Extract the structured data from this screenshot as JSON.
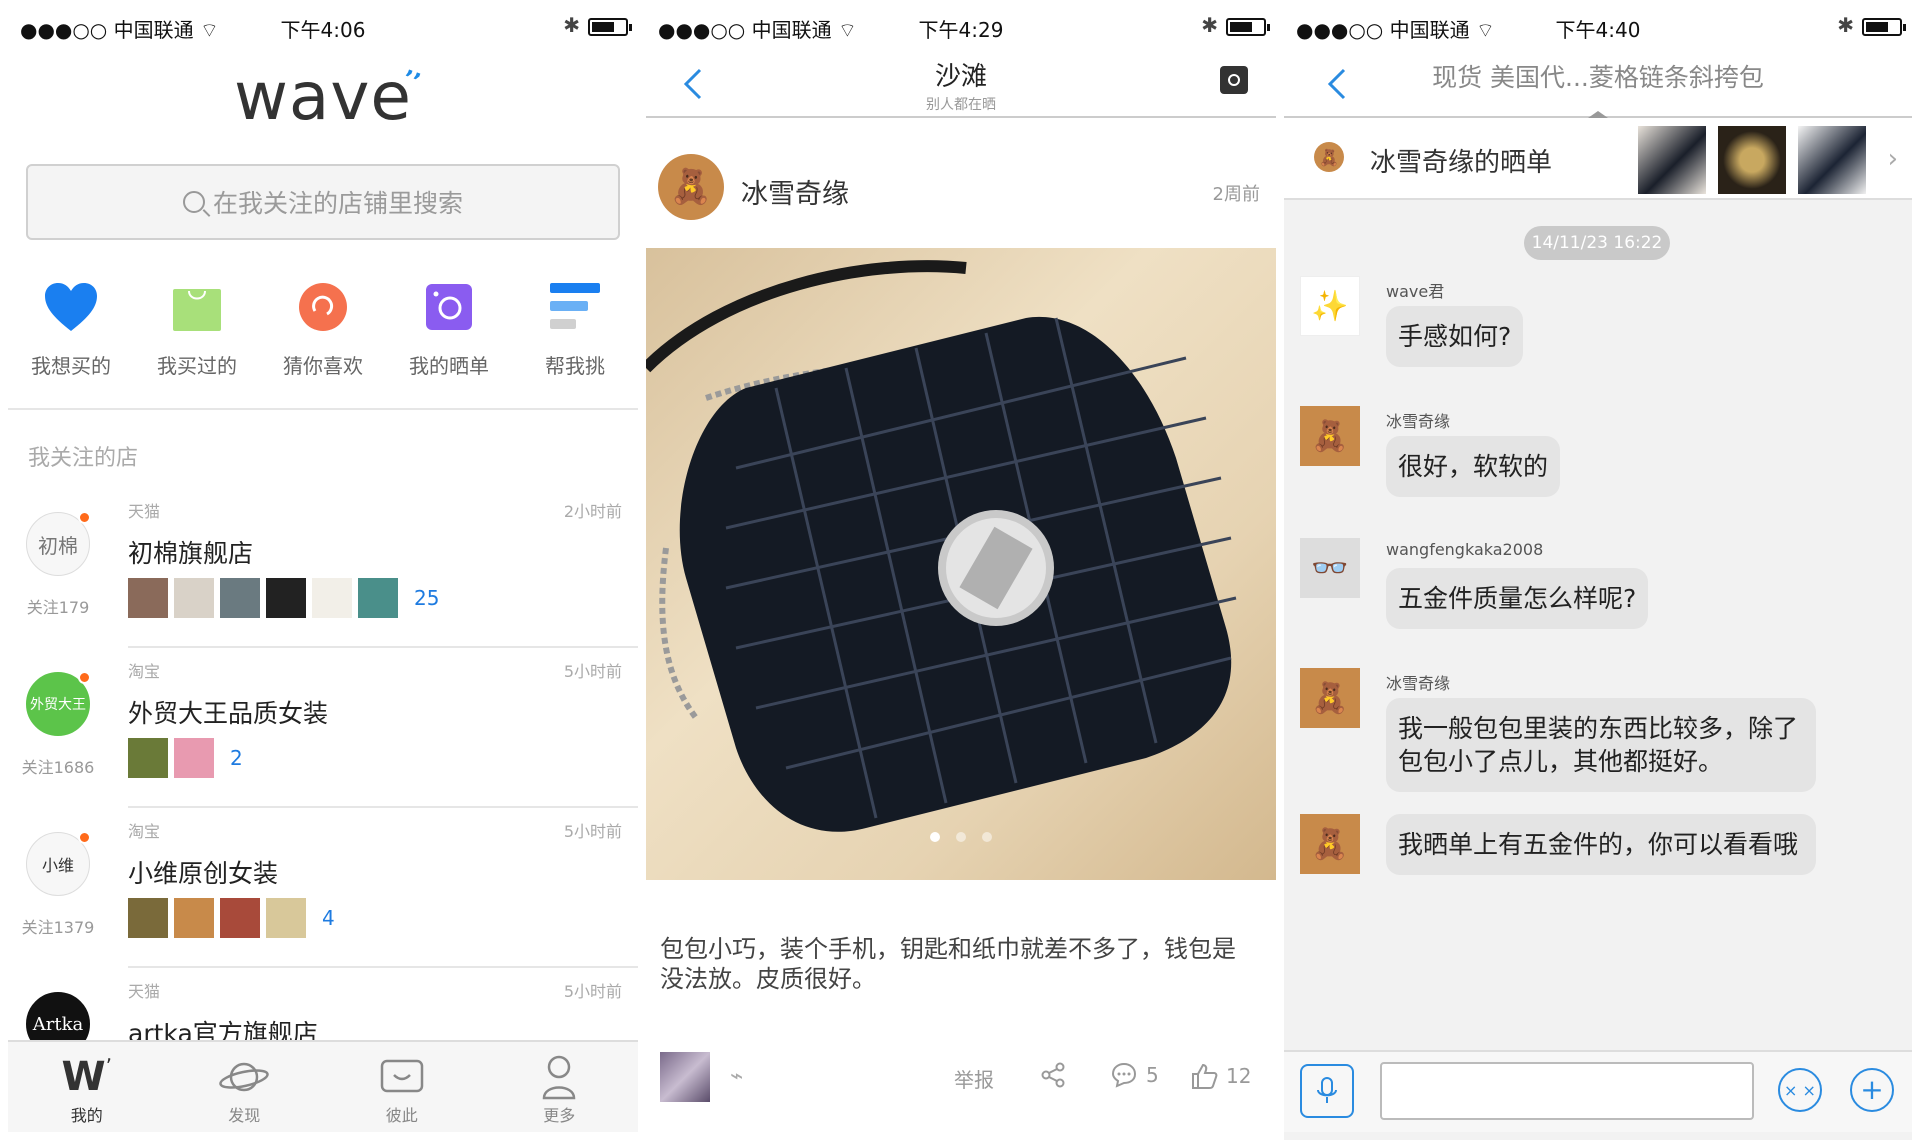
{
  "status_bars": [
    {
      "carrier": "●●●○○ 中国联通 ⌔",
      "time": "下午4:06"
    },
    {
      "carrier": "●●●○○ 中国联通 ⌔",
      "time": "下午4:29"
    },
    {
      "carrier": "●●●○○ 中国联通 ⌔",
      "time": "下午4:40"
    }
  ],
  "home": {
    "logo": "wave",
    "search_placeholder": "在我关注的店铺里搜索",
    "shortcuts": [
      {
        "label": "我想买的",
        "icon": "heart-icon",
        "color": "#1a7ff0"
      },
      {
        "label": "我买过的",
        "icon": "shopping-bag-icon",
        "color": "#a8e07a"
      },
      {
        "label": "猜你喜欢",
        "icon": "swirl-icon",
        "color": "#f5714e"
      },
      {
        "label": "我的晒单",
        "icon": "camera-icon",
        "color": "#8a5cf0"
      },
      {
        "label": "帮我挑",
        "icon": "list-bars-icon",
        "color": "#1a7ff0"
      }
    ],
    "section_title": "我关注的店",
    "shops": [
      {
        "platform": "天猫",
        "ago": "2小时前",
        "name": "初棉旗舰店",
        "avatar_text": "初棉",
        "follow": "关注179",
        "count": "25",
        "thumbs": [
          "#8a6a5a",
          "#d9d2c8",
          "#6a7a80",
          "#222222",
          "#f2efe8",
          "#4a8f8a"
        ]
      },
      {
        "platform": "淘宝",
        "ago": "5小时前",
        "name": "外贸大王品质女装",
        "avatar_text": "外贸大王",
        "follow": "关注1686",
        "count": "2",
        "thumbs": [
          "#6a7a38",
          "#e89ab0"
        ]
      },
      {
        "platform": "淘宝",
        "ago": "5小时前",
        "name": "小维原创女装",
        "avatar_text": "小维",
        "follow": "关注1379",
        "count": "4",
        "thumbs": [
          "#7a6a3a",
          "#c88a4a",
          "#a84a3a",
          "#d8c89a"
        ]
      },
      {
        "platform": "天猫",
        "ago": "5小时前",
        "name": "artka官方旗舰店",
        "avatar_text": "Artka",
        "follow": "",
        "count": "",
        "thumbs": []
      }
    ],
    "tabs": [
      {
        "label": "我的",
        "icon": "wave-logo-icon"
      },
      {
        "label": "发现",
        "icon": "planet-icon"
      },
      {
        "label": "彼此",
        "icon": "message-box-icon"
      },
      {
        "label": "更多",
        "icon": "person-icon"
      }
    ]
  },
  "post": {
    "title": "沙滩",
    "subtitle": "别人都在晒",
    "user": "冰雪奇缘",
    "ago": "2周前",
    "caption": "包包小巧，装个手机，钥匙和纸巾就差不多了，钱包是没法放。皮质很好。",
    "report_label": "举报",
    "comments": "5",
    "likes": "12"
  },
  "chat": {
    "title": "现货 美国代...菱格链条斜挎包",
    "show_label": "冰雪奇缘的晒单",
    "timestamp": "14/11/23 16:22",
    "messages": [
      {
        "who": "wave君",
        "text": "手感如何?",
        "avatar": "cartoon"
      },
      {
        "who": "冰雪奇缘",
        "text": "很好，软软的",
        "avatar": "bear"
      },
      {
        "who": "wangfengkaka2008",
        "text": "五金件质量怎么样呢?",
        "avatar": "glasses"
      },
      {
        "who": "冰雪奇缘",
        "text": "我一般包包里装的东西比较多，除了包包小了点儿，其他都挺好。",
        "avatar": "bear"
      },
      {
        "who": "",
        "text": "我晒单上有五金件的，你可以看看哦",
        "avatar": "bear"
      }
    ]
  }
}
